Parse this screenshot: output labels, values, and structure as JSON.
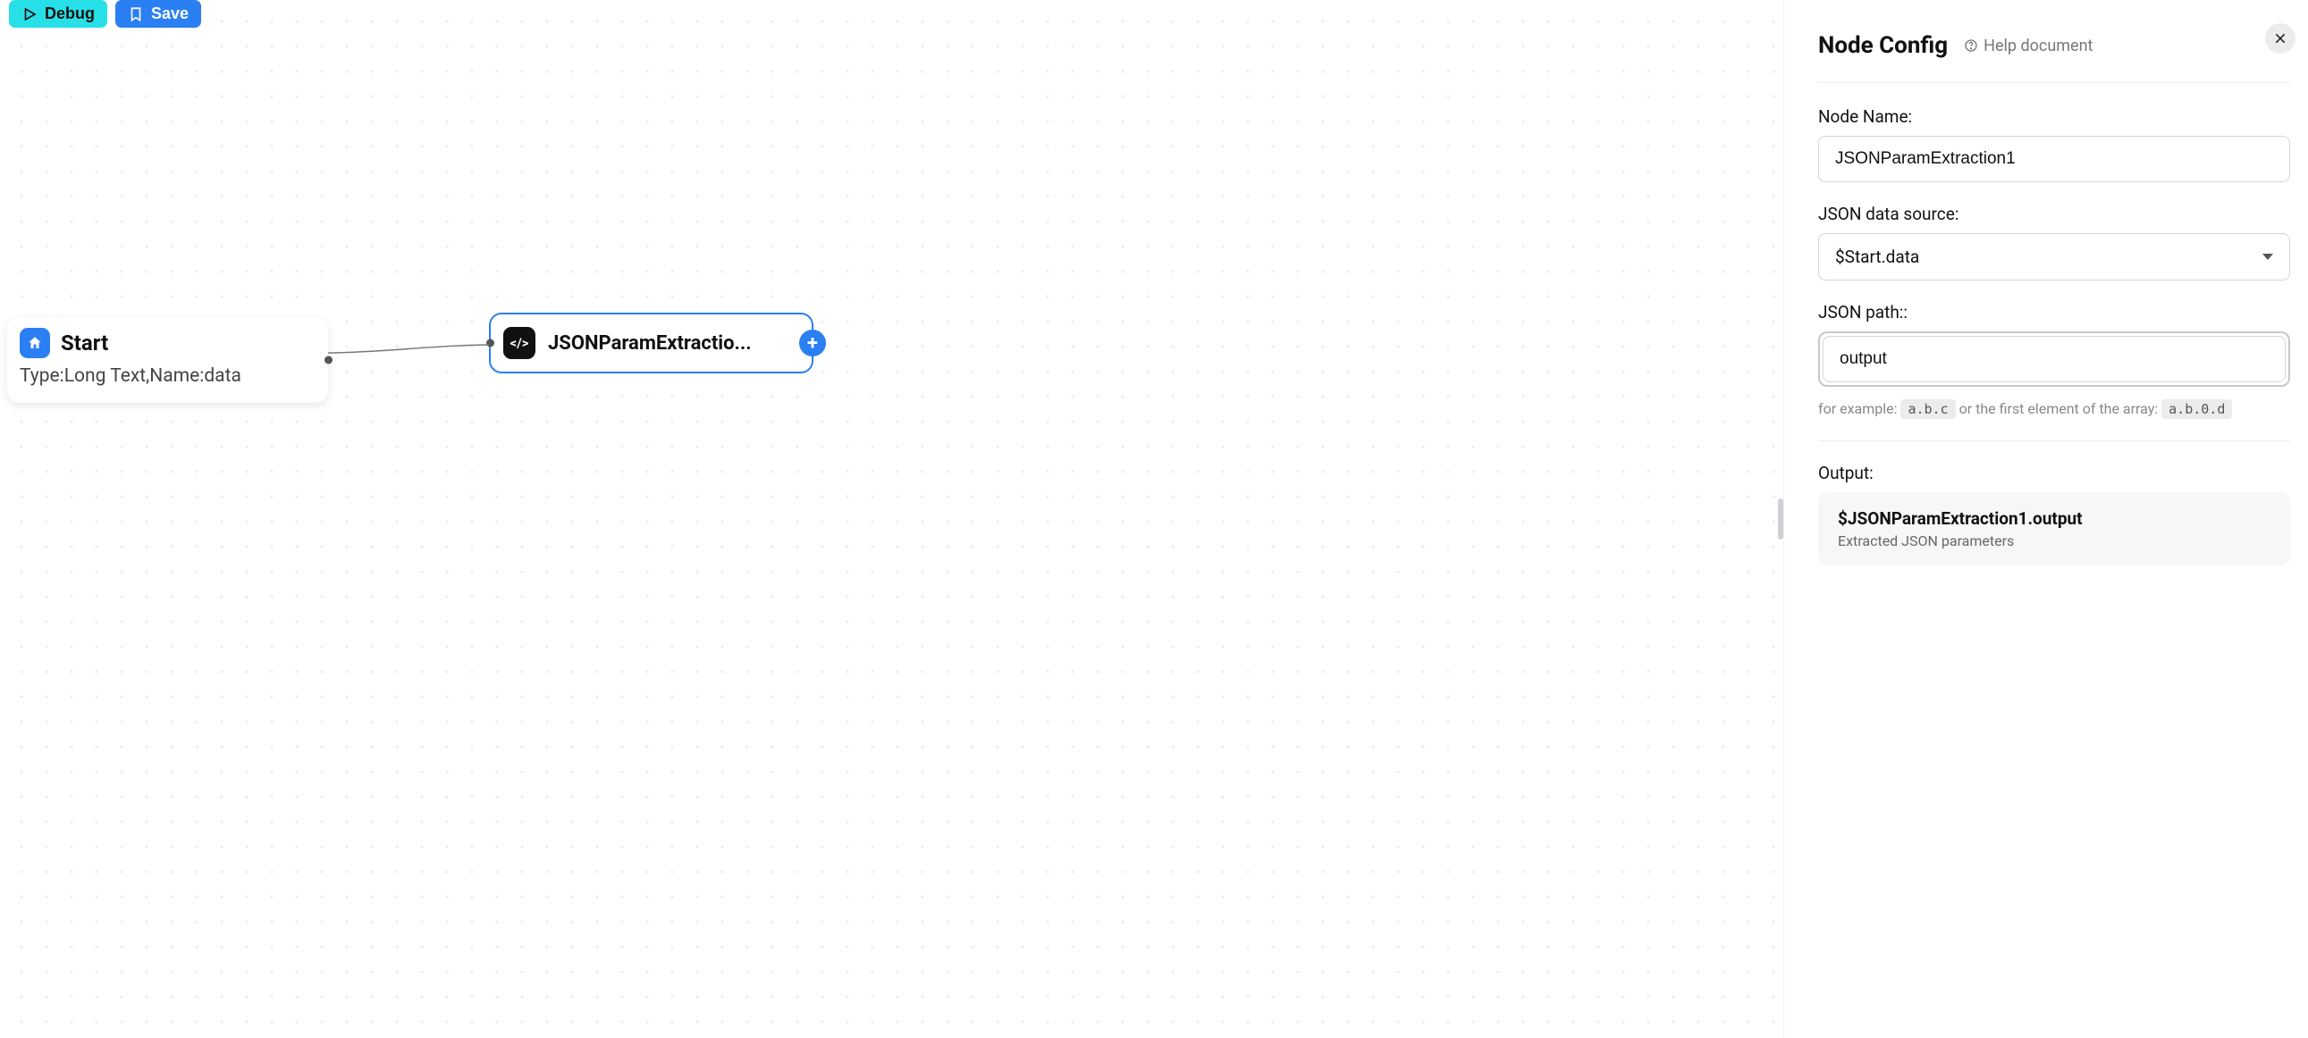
{
  "toolbar": {
    "debug_label": "Debug",
    "save_label": "Save"
  },
  "canvas": {
    "nodes": {
      "start": {
        "title": "Start",
        "subtitle": "Type:Long Text,Name:data"
      },
      "json": {
        "title": "JSONParamExtractio...",
        "icon_text": "</>"
      }
    }
  },
  "panel": {
    "title": "Node Config",
    "help_label": "Help document",
    "node_name_label": "Node Name:",
    "node_name_value": "JSONParamExtraction1",
    "json_source_label": "JSON data source:",
    "json_source_value": "$Start.data",
    "json_path_label": "JSON path::",
    "json_path_value": "output",
    "helper_prefix": "for example: ",
    "helper_chip1": "a.b.c",
    "helper_mid": " or the first element of the array: ",
    "helper_chip2": "a.b.0.d",
    "output_label": "Output:",
    "output_var": "$JSONParamExtraction1.output",
    "output_desc": "Extracted JSON parameters"
  }
}
